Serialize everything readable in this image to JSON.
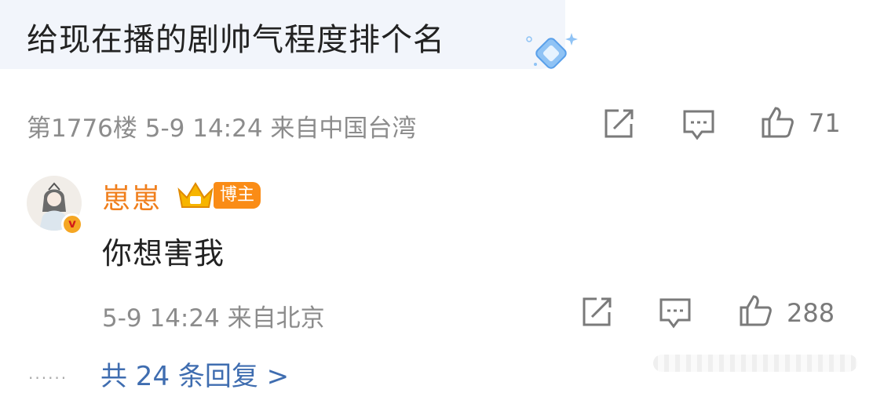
{
  "comment": {
    "text": "给现在播的剧帅气程度排个名",
    "meta": "第1776楼 5-9 14:24 来自中国台湾",
    "likes": "71"
  },
  "reply": {
    "author": "崽崽",
    "badge": "博主",
    "verified_mark": "v",
    "text": "你想害我",
    "meta": "5-9 14:24 来自北京",
    "likes": "288"
  },
  "more_replies": "共 24 条回复 >",
  "icons": {
    "share": "share-icon",
    "comment": "comment-icon",
    "like": "thumbs-up-icon",
    "sticker": "diamond-sticker-icon",
    "crown": "crown-icon"
  },
  "colors": {
    "username": "#f07e1b",
    "badge": "#fa8c16",
    "link": "#3f6db0",
    "meta": "#8c8c8c",
    "bubble": "#f2f5fb"
  }
}
